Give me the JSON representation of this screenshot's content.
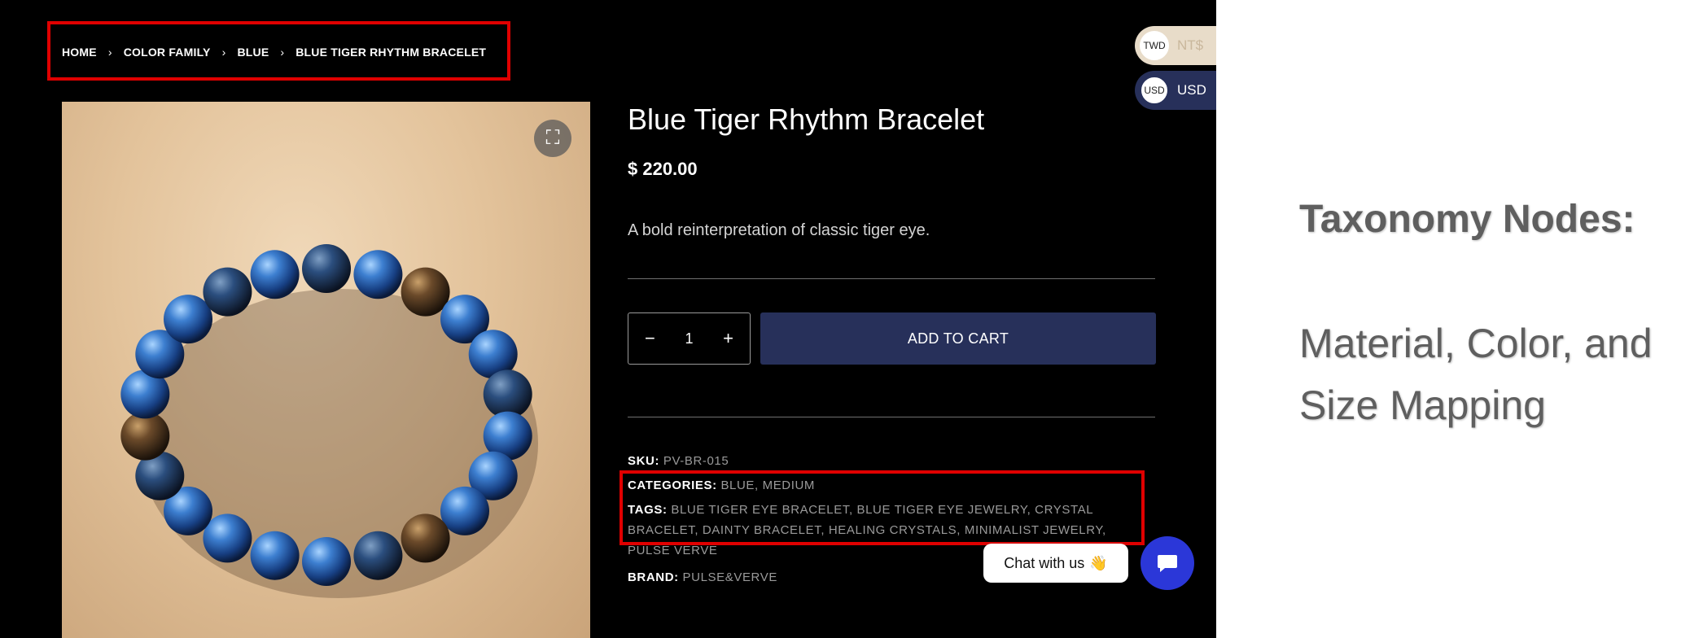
{
  "breadcrumb": {
    "items": [
      "HOME",
      "COLOR FAMILY",
      "BLUE",
      "BLUE TIGER RHYTHM BRACELET"
    ],
    "separator": "›"
  },
  "product": {
    "title": "Blue Tiger Rhythm Bracelet",
    "price": "$ 220.00",
    "description": "A bold reinterpretation of classic tiger eye.",
    "quantity": "1",
    "add_to_cart_label": "ADD TO CART",
    "image_alt_icon": "fullscreen-icon"
  },
  "meta": {
    "sku_label": "SKU:",
    "sku_value": "PV-BR-015",
    "categories_label": "CATEGORIES:",
    "categories": [
      "BLUE",
      "MEDIUM"
    ],
    "tags_label": "TAGS:",
    "tags": [
      "BLUE TIGER EYE BRACELET",
      "BLUE TIGER EYE JEWELRY",
      "CRYSTAL BRACELET",
      "DAINTY BRACELET",
      "HEALING CRYSTALS",
      "MINIMALIST JEWELRY",
      "PULSE VERVE"
    ],
    "brand_label": "BRAND:",
    "brand_value": "PULSE&VERVE"
  },
  "currency_switcher": [
    {
      "badge": "TWD",
      "code": "NT$",
      "bg": "#e8dcc9",
      "text_color": "#c9b79c"
    },
    {
      "badge": "USD",
      "code": "USD",
      "bg": "#27305a",
      "text_color": "#ffffff"
    }
  ],
  "chat": {
    "label": "Chat with us",
    "emoji": "👋",
    "bubble_color": "#2b37d8"
  },
  "annotation": {
    "heading": "Taxonomy Nodes:",
    "line1": "Material, Color, and",
    "line2": "Size Mapping"
  },
  "colors": {
    "highlight": "#e00000",
    "button": "#27305a",
    "page_bg": "#000000"
  }
}
